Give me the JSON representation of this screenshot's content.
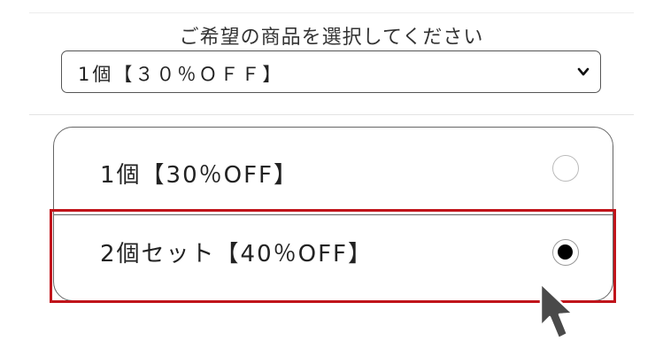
{
  "form": {
    "prompt": "ご希望の商品を選択してください",
    "select": {
      "value": "1個【３０％ＯＦＦ】"
    },
    "options": [
      {
        "label": "1個【30％OFF】",
        "selected": false
      },
      {
        "label": "2個セット【40％OFF】",
        "selected": true
      }
    ]
  },
  "colors": {
    "highlight": "#c0141b",
    "cursor": "#4a4a4a"
  },
  "icons": {
    "select_chevron": "chevron-down-icon",
    "pointer": "mouse-cursor-icon"
  }
}
